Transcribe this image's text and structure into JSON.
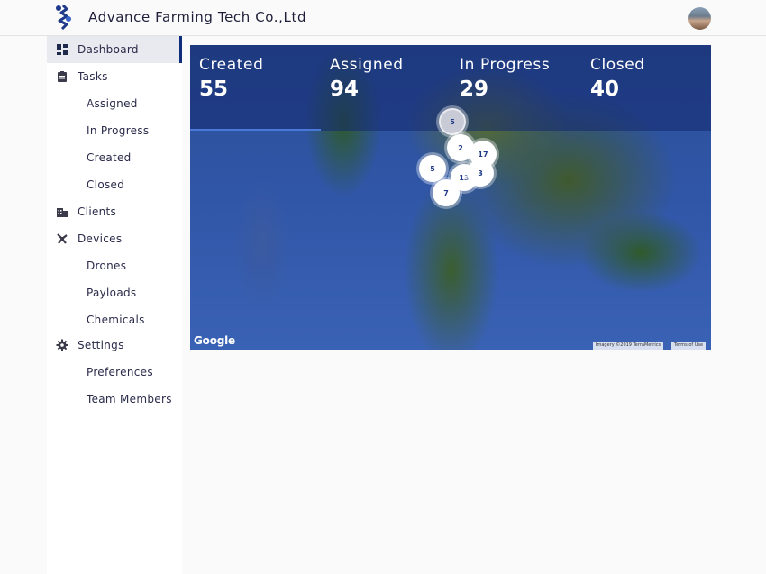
{
  "header": {
    "brand": "Advance Farming Tech Co.,Ltd"
  },
  "sidebar": {
    "items": [
      {
        "label": "Dashboard",
        "icon": "dashboard-icon",
        "active": true
      },
      {
        "label": "Tasks",
        "icon": "clipboard-icon"
      },
      {
        "label": "Assigned"
      },
      {
        "label": "In Progress"
      },
      {
        "label": "Created"
      },
      {
        "label": "Closed"
      },
      {
        "label": "Clients",
        "icon": "building-icon"
      },
      {
        "label": "Devices",
        "icon": "drone-icon"
      },
      {
        "label": "Drones"
      },
      {
        "label": "Payloads"
      },
      {
        "label": "Chemicals"
      },
      {
        "label": "Settings",
        "icon": "gear-icon"
      },
      {
        "label": "Preferences"
      },
      {
        "label": "Team Members"
      }
    ]
  },
  "stats": [
    {
      "label": "Created",
      "value": "55"
    },
    {
      "label": "Assigned",
      "value": "94"
    },
    {
      "label": "In Progress",
      "value": "29"
    },
    {
      "label": "Closed",
      "value": "40"
    }
  ],
  "map": {
    "clusters": [
      "5",
      "2",
      "17",
      "5",
      "13",
      "3",
      "7"
    ],
    "google_label": "Google",
    "imagery_label": "Imagery ©2019 TerraMetrics",
    "terms_label": "Terms of Use"
  },
  "colors": {
    "accent": "#0f2d7a",
    "nav_text": "#2a2a4a"
  }
}
